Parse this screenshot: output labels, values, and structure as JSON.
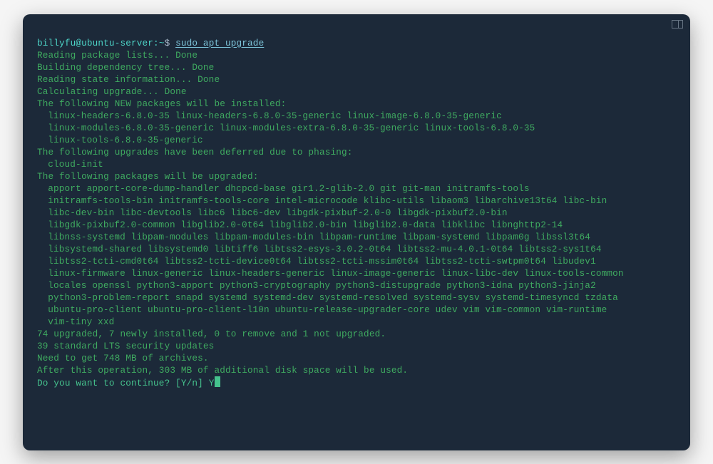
{
  "prompt": {
    "user": "billyfu@ubuntu-server",
    "separator": ":",
    "path": "~",
    "symbol": "$",
    "command": "sudo apt upgrade"
  },
  "progress": {
    "reading_lists": "Reading package lists...",
    "dependency_tree": "Building dependency tree...",
    "state_info": "Reading state information...",
    "calc_upgrade": "Calculating upgrade...",
    "done": "Done"
  },
  "sections": {
    "new_header": "The following NEW packages will be installed:",
    "new_lines": [
      "linux-headers-6.8.0-35 linux-headers-6.8.0-35-generic linux-image-6.8.0-35-generic",
      "linux-modules-6.8.0-35-generic linux-modules-extra-6.8.0-35-generic linux-tools-6.8.0-35",
      "linux-tools-6.8.0-35-generic"
    ],
    "deferred_header": "The following upgrades have been deferred due to phasing:",
    "deferred_lines": [
      "cloud-init"
    ],
    "upgrade_header": "The following packages will be upgraded:",
    "upgrade_lines": [
      "apport apport-core-dump-handler dhcpcd-base gir1.2-glib-2.0 git git-man initramfs-tools",
      "initramfs-tools-bin initramfs-tools-core intel-microcode klibc-utils libaom3 libarchive13t64 libc-bin",
      "libc-dev-bin libc-devtools libc6 libc6-dev libgdk-pixbuf-2.0-0 libgdk-pixbuf2.0-bin",
      "libgdk-pixbuf2.0-common libglib2.0-0t64 libglib2.0-bin libglib2.0-data libklibc libnghttp2-14",
      "libnss-systemd libpam-modules libpam-modules-bin libpam-runtime libpam-systemd libpam0g libssl3t64",
      "libsystemd-shared libsystemd0 libtiff6 libtss2-esys-3.0.2-0t64 libtss2-mu-4.0.1-0t64 libtss2-sys1t64",
      "libtss2-tcti-cmd0t64 libtss2-tcti-device0t64 libtss2-tcti-mssim0t64 libtss2-tcti-swtpm0t64 libudev1",
      "linux-firmware linux-generic linux-headers-generic linux-image-generic linux-libc-dev linux-tools-common",
      "locales openssl python3-apport python3-cryptography python3-distupgrade python3-idna python3-jinja2",
      "python3-problem-report snapd systemd systemd-dev systemd-resolved systemd-sysv systemd-timesyncd tzdata",
      "ubuntu-pro-client ubuntu-pro-client-l10n ubuntu-release-upgrader-core udev vim vim-common vim-runtime",
      "vim-tiny xxd"
    ]
  },
  "summary": {
    "counts": "74 upgraded, 7 newly installed, 0 to remove and 1 not upgraded.",
    "security": "39 standard LTS security updates",
    "download": "Need to get 748 MB of archives.",
    "disk": "After this operation, 303 MB of additional disk space will be used."
  },
  "confirm": {
    "question": "Do you want to continue? [Y/n]",
    "answer": "Y"
  },
  "colors": {
    "background": "#1c2939",
    "text_primary": "#3faa60",
    "prompt_user": "#4dd4c7",
    "command": "#7cc3d8",
    "cursor": "#45c28d"
  }
}
